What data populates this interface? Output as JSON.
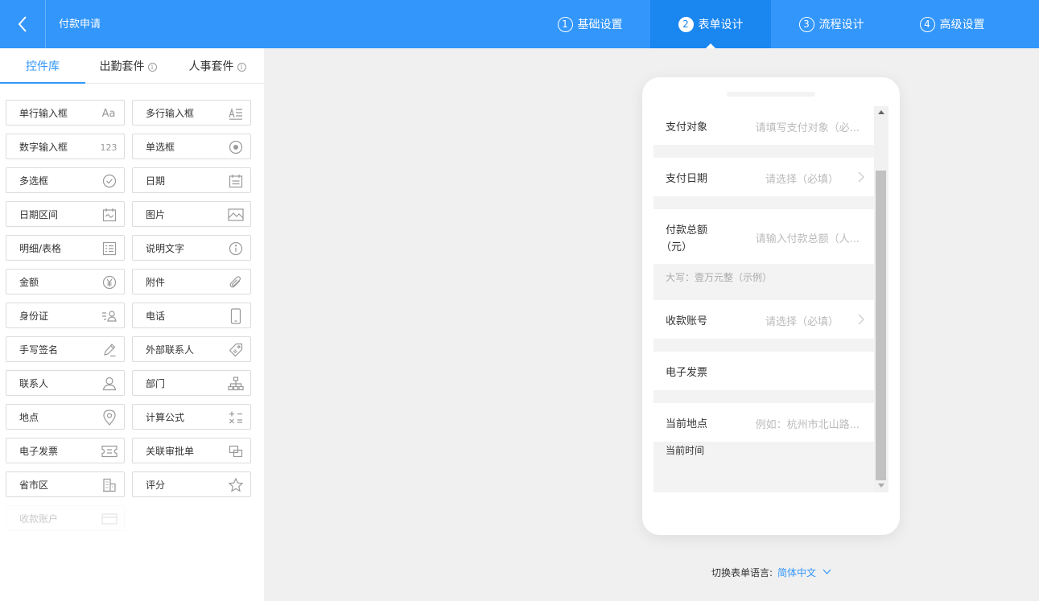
{
  "header": {
    "title": "付款申请",
    "steps": [
      {
        "num": "1",
        "label": "基础设置"
      },
      {
        "num": "2",
        "label": "表单设计"
      },
      {
        "num": "3",
        "label": "流程设计"
      },
      {
        "num": "4",
        "label": "高级设置"
      }
    ],
    "active_step": "2"
  },
  "sidebar": {
    "tabs": [
      {
        "label": "控件库"
      },
      {
        "label": "出勤套件",
        "info": "i"
      },
      {
        "label": "人事套件",
        "info": "i"
      }
    ],
    "controls": [
      {
        "label": "单行输入框",
        "icon": "Aa"
      },
      {
        "label": "多行输入框",
        "icon": "multiline-icon"
      },
      {
        "label": "数字输入框",
        "icon": "123"
      },
      {
        "label": "单选框",
        "icon": "radio-icon"
      },
      {
        "label": "多选框",
        "icon": "checkbox-icon"
      },
      {
        "label": "日期",
        "icon": "calendar-icon"
      },
      {
        "label": "日期区间",
        "icon": "date-range-icon"
      },
      {
        "label": "图片",
        "icon": "image-icon"
      },
      {
        "label": "明细/表格",
        "icon": "table-icon"
      },
      {
        "label": "说明文字",
        "icon": "info-icon"
      },
      {
        "label": "金额",
        "icon": "yen-icon"
      },
      {
        "label": "附件",
        "icon": "paperclip-icon"
      },
      {
        "label": "身份证",
        "icon": "id-card-icon"
      },
      {
        "label": "电话",
        "icon": "phone-icon"
      },
      {
        "label": "手写签名",
        "icon": "pen-icon"
      },
      {
        "label": "外部联系人",
        "icon": "tag-icon"
      },
      {
        "label": "联系人",
        "icon": "person-icon"
      },
      {
        "label": "部门",
        "icon": "org-chart-icon"
      },
      {
        "label": "地点",
        "icon": "location-icon"
      },
      {
        "label": "计算公式",
        "icon": "formula-icon"
      },
      {
        "label": "电子发票",
        "icon": "ticket-icon"
      },
      {
        "label": "关联审批单",
        "icon": "link-icon"
      },
      {
        "label": "省市区",
        "icon": "building-icon"
      },
      {
        "label": "评分",
        "icon": "star-icon"
      },
      {
        "label": "收款账户",
        "icon": "card-icon"
      }
    ]
  },
  "form": {
    "fields": [
      {
        "label": "支付对象",
        "value": "请填写支付对象（必..."
      },
      {
        "label": "支付日期",
        "value": "请选择（必填）"
      },
      {
        "label": "付款总额",
        "label2": "（元）",
        "value": "请输入付款总额（人..."
      },
      {
        "hint": "大写：壹万元整（示例）"
      },
      {
        "label": "收款账号",
        "value": "请选择（必填）"
      },
      {
        "label": "电子发票"
      },
      {
        "label": "当前地点",
        "value": "例如：杭州市北山路..."
      },
      {
        "hint": "当前时间"
      }
    ]
  },
  "language": {
    "label": "切换表单语言:",
    "value": "简体中文"
  },
  "colors": {
    "primary": "#3296fa",
    "active_step": "#1a86f0"
  }
}
